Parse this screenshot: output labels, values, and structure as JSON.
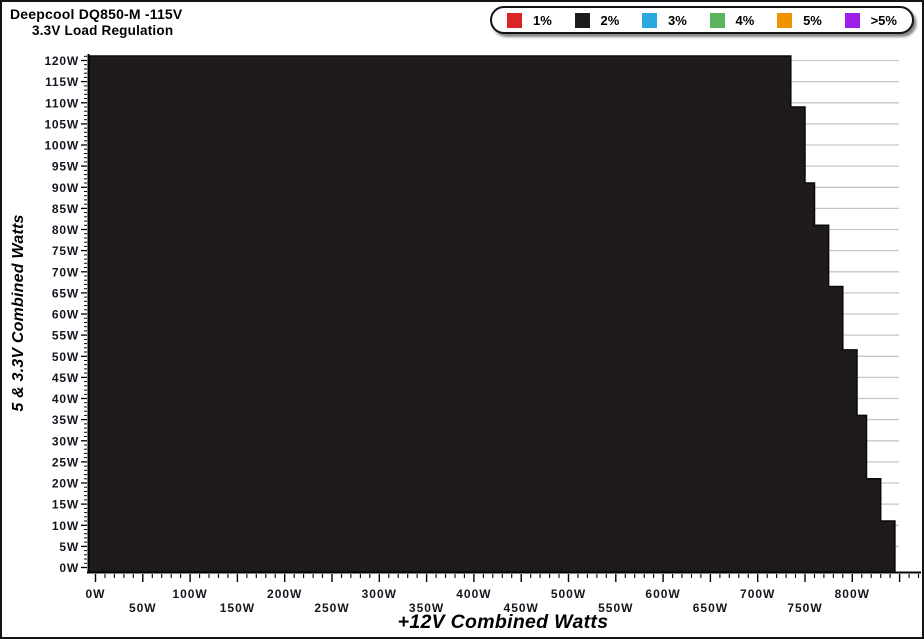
{
  "chart_data": {
    "type": "area",
    "title": "Deepcool DQ850-M -115V",
    "subtitle": "3.3V Load Regulation",
    "xlabel": "+12V Combined Watts",
    "ylabel": "5 & 3.3V Combined Watts",
    "xlim": [
      0,
      875
    ],
    "ylim": [
      0,
      122
    ],
    "x_major_step": 50,
    "x_minor_step": 10,
    "y_major_step": 5,
    "y_minor_step": 1,
    "grid": "horizontal-only",
    "gridline_color": "#c6c6c6",
    "legend_position": "top-right",
    "legend": {
      "items": [
        {
          "label": "1%",
          "color": "#da2428"
        },
        {
          "label": "2%",
          "color": "#1b1b1b"
        },
        {
          "label": "3%",
          "color": "#29a8dd"
        },
        {
          "label": "4%",
          "color": "#5bb45e"
        },
        {
          "label": "5%",
          "color": "#f09300"
        },
        {
          "label": ">5%",
          "color": "#9d20ea"
        }
      ]
    },
    "region_value": "2%",
    "region_color": "#1f1b1b",
    "x_tick_labels": [
      "0W",
      "50W",
      "100W",
      "150W",
      "200W",
      "250W",
      "300W",
      "350W",
      "400W",
      "450W",
      "500W",
      "550W",
      "600W",
      "650W",
      "700W",
      "750W",
      "800W"
    ],
    "y_tick_labels": [
      "0W",
      "5W",
      "10W",
      "15W",
      "20W",
      "25W",
      "30W",
      "35W",
      "40W",
      "45W",
      "50W",
      "55W",
      "60W",
      "65W",
      "70W",
      "75W",
      "80W",
      "85W",
      "90W",
      "95W",
      "100W",
      "105W",
      "110W",
      "115W",
      "120W"
    ],
    "steps": [
      {
        "minor_from": 109,
        "minor_to": 122,
        "max_12v": 735
      },
      {
        "minor_from": 91,
        "minor_to": 109,
        "max_12v": 750
      },
      {
        "minor_from": 81,
        "minor_to": 91,
        "max_12v": 760
      },
      {
        "minor_from": 66.5,
        "minor_to": 81,
        "max_12v": 775
      },
      {
        "minor_from": 51.5,
        "minor_to": 66.5,
        "max_12v": 790
      },
      {
        "minor_from": 36,
        "minor_to": 51.5,
        "max_12v": 805
      },
      {
        "minor_from": 21,
        "minor_to": 36,
        "max_12v": 815
      },
      {
        "minor_from": 11,
        "minor_to": 21,
        "max_12v": 830
      },
      {
        "minor_from": 0,
        "minor_to": 11,
        "max_12v": 845
      }
    ]
  }
}
